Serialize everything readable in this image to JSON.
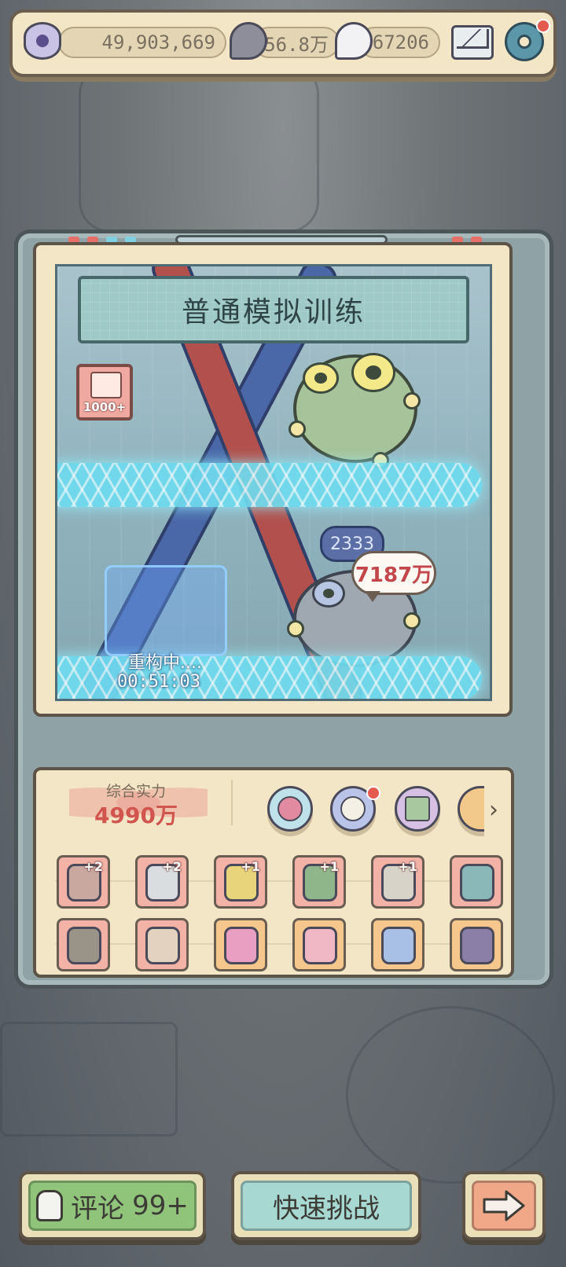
{
  "resources": {
    "eye_points": "49,903,669",
    "gray_souls": "56.8万",
    "white_souls": "67206"
  },
  "mode_title": "普通模拟训练",
  "stage_badge": "1000+",
  "enemies": [
    {
      "level": "2333",
      "damage": "7187万"
    }
  ],
  "rebuild": {
    "status": "重构中....",
    "timer": "00:51:03"
  },
  "power": {
    "label": "综合实力",
    "value": "4990万"
  },
  "skills": [
    "crab-skill-icon",
    "mushroom-skill-icon",
    "rune-skill-icon",
    "orb-skill-icon"
  ],
  "equipment_row1": [
    {
      "name": "hammer-icon",
      "plus": "+2",
      "tier": "red"
    },
    {
      "name": "blade-icon",
      "plus": "+2",
      "tier": "red"
    },
    {
      "name": "staff-icon",
      "plus": "+1",
      "tier": "red"
    },
    {
      "name": "axe-icon",
      "plus": "+1",
      "tier": "red"
    },
    {
      "name": "sword-icon",
      "plus": "+1",
      "tier": "red"
    },
    {
      "name": "helmet-icon",
      "plus": "",
      "tier": "red"
    }
  ],
  "equipment_row2": [
    {
      "name": "armor-plate-icon",
      "plus": "",
      "tier": "red"
    },
    {
      "name": "pants-icon",
      "plus": "",
      "tier": "red"
    },
    {
      "name": "claw-glove-icon",
      "plus": "",
      "tier": "orange"
    },
    {
      "name": "vest-icon",
      "plus": "",
      "tier": "orange"
    },
    {
      "name": "dress-icon",
      "plus": "",
      "tier": "orange"
    },
    {
      "name": "drill-boot-icon",
      "plus": "",
      "tier": "orange"
    }
  ],
  "buttons": {
    "comment_label": "评论",
    "comment_count": "99+",
    "quick_challenge": "快速挑战"
  },
  "colors": {
    "panel": "#f3e6c6",
    "accent_red": "#d0554f",
    "holo": "#6fdcef"
  }
}
